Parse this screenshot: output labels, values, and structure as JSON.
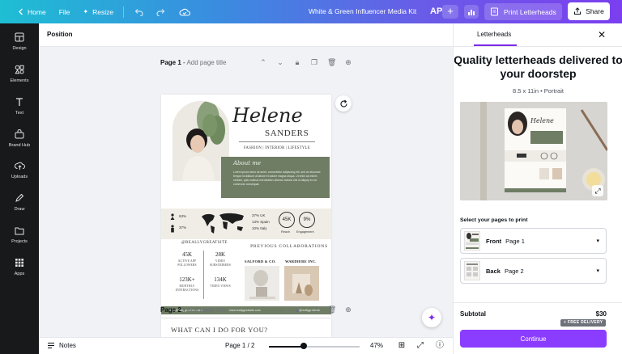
{
  "topbar": {
    "home_label": "Home",
    "file_label": "File",
    "resize_label": "Resize",
    "doc_title": "White & Green Influencer Media Kit",
    "avatar_initials": "AP",
    "print_label": "Print Letterheads",
    "share_label": "Share",
    "gradient_start": "#1ebed3",
    "gradient_end": "#7b3ff0"
  },
  "rail": {
    "items": [
      {
        "label": "Design",
        "icon": "layout-icon"
      },
      {
        "label": "Elements",
        "icon": "elements-icon"
      },
      {
        "label": "Text",
        "icon": "text-icon"
      },
      {
        "label": "Brand Hub",
        "icon": "brand-hub-icon"
      },
      {
        "label": "Uploads",
        "icon": "upload-cloud-icon"
      },
      {
        "label": "Draw",
        "icon": "pen-icon"
      },
      {
        "label": "Projects",
        "icon": "folder-icon"
      },
      {
        "label": "Apps",
        "icon": "apps-grid-icon"
      }
    ]
  },
  "canvas": {
    "position_label": "Position",
    "page1": {
      "prefix": "Page 1",
      "title_placeholder": "Add page title"
    },
    "page2": {
      "prefix": "Page 2",
      "title_placeholder": "Add page title"
    },
    "page2_heading": "WHAT CAN I DO FOR YOU?"
  },
  "design": {
    "name": "Helene",
    "surname": "SANDERS",
    "roles": "FASHION | INTERIOR | LIFESTYLE",
    "about_heading": "About me",
    "about_text": "Lorem ipsum dolor sit amet, consectetur adipiscing elit, sed do eiusmod tempor incididunt ut labore et dolore magna aliqua. Ut enim ad minim veniam, quis nostrud exercitation ullamco laboris nisi ut aliquip ex ea commodo consequat.",
    "female_pct": "63%",
    "male_pct": "37%",
    "countries": [
      "37% UK",
      "13% Spain",
      "10% Italy"
    ],
    "reach_value": "45K",
    "reach_label": "Reach",
    "engagement_value": "9%",
    "engagement_label": "Engagement",
    "handle": "@REALLYGREATSITE",
    "metrics": [
      {
        "value": "45K",
        "label": "ACTIVE APP FOLLOWERS"
      },
      {
        "value": "28K",
        "label": "VIDEO SUBSCRIBERS"
      },
      {
        "value": "123K+",
        "label": "MONTHLY INTERACTIONS"
      },
      {
        "value": "134K",
        "label": "VIDEO VIEWS"
      }
    ],
    "collab_title": "PREVIOUS COLLABORATIONS",
    "brands": [
      "SALFORD & CO.",
      "WARDIERE INC."
    ],
    "footer": [
      "hello@reallygreatsite.com",
      "www.reallygreatsite.com",
      "@reallygreatsite"
    ],
    "accent_green": "#6e7d64"
  },
  "bottombar": {
    "notes_label": "Notes",
    "page_indicator": "Page 1 / 2",
    "zoom": "47%",
    "zoom_fraction": 0.38
  },
  "panel": {
    "tab_label": "Letterheads",
    "title": "Quality letterheads delivered to your doorstep",
    "subtitle": "8.5 x 11in • Portrait",
    "select_label": "Select your pages to print",
    "pages": [
      {
        "side": "Front",
        "page": "Page 1"
      },
      {
        "side": "Back",
        "page": "Page 2"
      }
    ],
    "subtotal_label": "Subtotal",
    "subtotal_value": "$30",
    "free_delivery": "+ FREE DELIVERY",
    "continue_label": "Continue",
    "accent": "#8b3dff"
  }
}
